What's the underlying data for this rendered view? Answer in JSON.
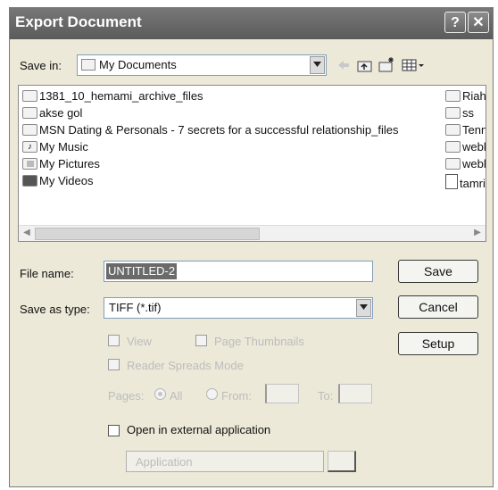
{
  "dialog": {
    "title": "Export Document",
    "help_label": "?",
    "close_label": "✕"
  },
  "save_in": {
    "label": "Save in:",
    "value": "My Documents",
    "toolbar": [
      "back-icon",
      "up-folder-icon",
      "new-folder-icon",
      "view-menu-icon"
    ]
  },
  "files": [
    {
      "name": "1381_10_hemami_archive_files",
      "icon": "folder-icon"
    },
    {
      "name": "akse gol",
      "icon": "folder-icon"
    },
    {
      "name": "MSN Dating & Personals - 7 secrets for a successful relationship_files",
      "icon": "folder-icon"
    },
    {
      "name": "My Music",
      "icon": "music-folder-icon"
    },
    {
      "name": "My Pictures",
      "icon": "pictures-folder-icon"
    },
    {
      "name": "My Videos",
      "icon": "videos-folder-icon"
    },
    {
      "name": "Riahi",
      "icon": "folder-icon"
    },
    {
      "name": "ss",
      "icon": "folder-icon"
    },
    {
      "name": "Tennis",
      "icon": "folder-icon"
    },
    {
      "name": "weblo",
      "icon": "folder-icon"
    },
    {
      "name": "weblo",
      "icon": "folder-icon"
    },
    {
      "name": "tamrin",
      "icon": "document-icon"
    }
  ],
  "file_name": {
    "label": "File name:",
    "value": "UNTITLED-2"
  },
  "save_as_type": {
    "label": "Save as type:",
    "value": "TIFF (*.tif)"
  },
  "buttons": {
    "save": "Save",
    "cancel": "Cancel",
    "setup": "Setup"
  },
  "options": {
    "selection_label": "View",
    "page_label": "Page Thumbnails",
    "reader_label": "Reader Spreads Mode",
    "pages_label": "Pages:",
    "all_label": "All",
    "from_label": "From:",
    "to_label": "To:",
    "open_external_label": "Open in external application",
    "application_placeholder": "Application"
  },
  "colors": {
    "title_bar": "#5b5b5b",
    "dialog_bg": "#ece9d8",
    "selection": "#6a6a6a"
  }
}
